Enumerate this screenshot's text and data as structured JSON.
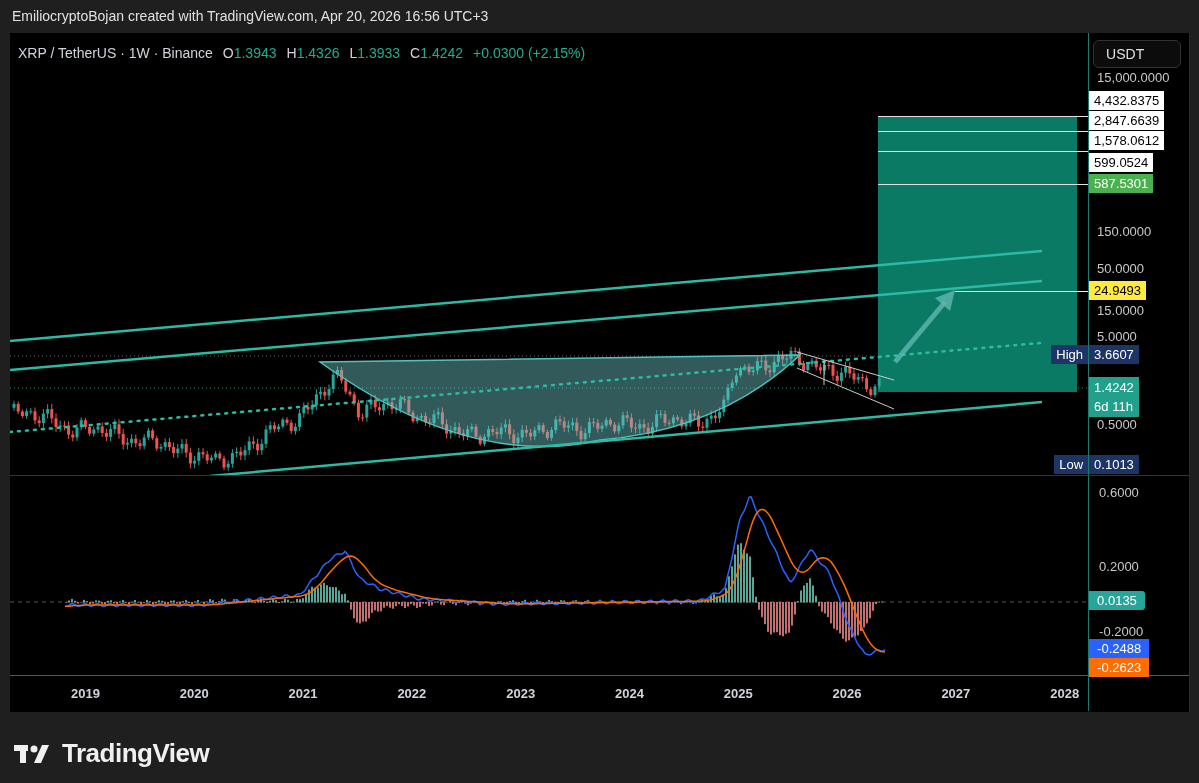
{
  "attribution": "EmiliocryptoBojan created with TradingView.com, Apr 20, 2026 16:56 UTC+3",
  "legend": {
    "symbol": "XRP / TetherUS · 1W · Binance",
    "ohlc": [
      {
        "label": "O",
        "value": "1.3943"
      },
      {
        "label": "H",
        "value": "1.4326"
      },
      {
        "label": "L",
        "value": "1.3933"
      },
      {
        "label": "C",
        "value": "1.4242"
      }
    ],
    "change": "+0.0300 (+2.15%)"
  },
  "currency_button": "USDT",
  "price_axis": {
    "ticks": [
      "15,000.0000",
      "150.0000",
      "50.0000",
      "15.0000",
      "5.0000",
      "0.5000"
    ],
    "tags": [
      {
        "kind": "target",
        "value": "4,432.8375"
      },
      {
        "kind": "target",
        "value": "2,847.6639"
      },
      {
        "kind": "target",
        "value": "1,578.0612"
      },
      {
        "kind": "target",
        "value": "599.0524"
      },
      {
        "kind": "entry",
        "value": "587.5301"
      },
      {
        "kind": "marker",
        "value": "24.9493"
      },
      {
        "kind": "high",
        "label": "High",
        "value": "3.6607"
      },
      {
        "kind": "current",
        "value": "1.4242",
        "countdown": "6d 11h"
      },
      {
        "kind": "low",
        "label": "Low",
        "value": "0.1013"
      }
    ]
  },
  "macd_axis": {
    "ticks": [
      "0.6000",
      "0.2000",
      "-0.2000"
    ],
    "tags": [
      {
        "kind": "histogram",
        "value": "0.0135"
      },
      {
        "kind": "macd",
        "value": "-0.2488"
      },
      {
        "kind": "signal",
        "value": "-0.2623"
      }
    ]
  },
  "time_axis": [
    "2019",
    "2020",
    "2021",
    "2022",
    "2023",
    "2024",
    "2025",
    "2026",
    "2027",
    "2028"
  ],
  "brand": "TradingView"
}
